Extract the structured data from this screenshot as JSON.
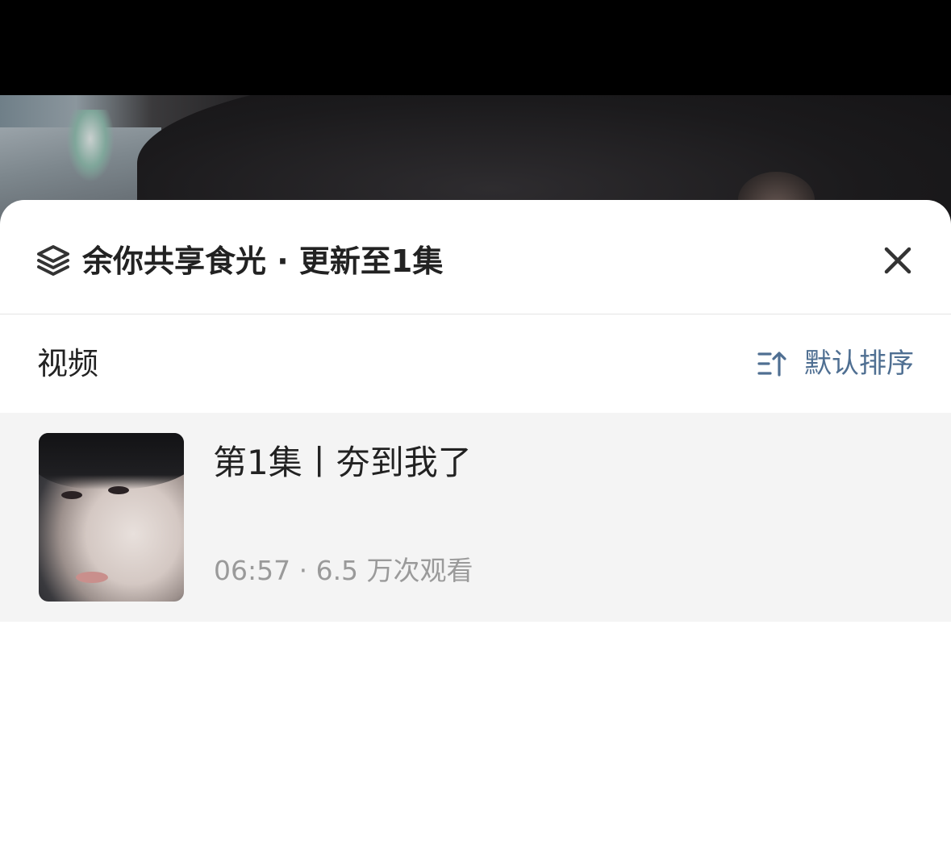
{
  "sheet": {
    "title": "余你共享食光 · 更新至1集"
  },
  "section": {
    "title": "视频",
    "sort_label": "默认排序"
  },
  "episodes": [
    {
      "title": "第1集丨夯到我了",
      "meta": "06:57 · 6.5 万次观看"
    }
  ],
  "colors": {
    "sort_accent": "#4f6f92",
    "row_background": "#f4f4f4",
    "meta_text": "#9a9a9a"
  },
  "icons": {
    "header": "layers-icon",
    "close": "close-icon",
    "sort": "sort-icon"
  }
}
